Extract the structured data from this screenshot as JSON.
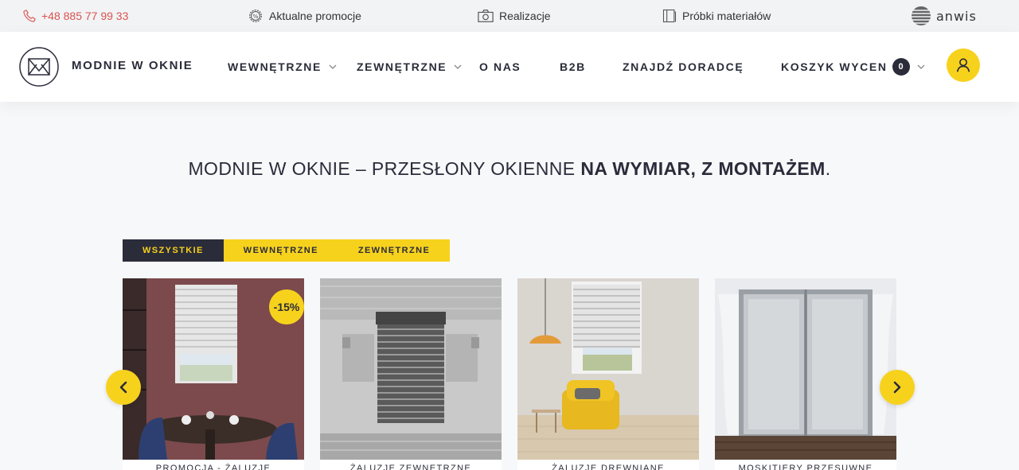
{
  "topbar": {
    "phone": "+48 885 77 99 33",
    "promotions": "Aktualne promocje",
    "realizations": "Realizacje",
    "samples": "Próbki materiałów",
    "partner_logo": "anwis"
  },
  "header": {
    "brand": "MODNIE W OKNIE",
    "nav": [
      {
        "label": "WEWNĘTRZNE",
        "has_dropdown": true
      },
      {
        "label": "ZEWNĘTRZNE",
        "has_dropdown": true
      },
      {
        "label": "O NAS"
      },
      {
        "label": "B2B"
      },
      {
        "label": "ZNAJDŹ DORADCĘ"
      },
      {
        "label": "KOSZYK WYCEN",
        "badge": "0",
        "has_dropdown": true
      }
    ],
    "user_icon": "user-icon"
  },
  "hero": {
    "headline_regular": "MODNIE W OKNIE – PRZESŁONY OKIENNE ",
    "headline_bold": "NA WYMIAR, Z MONTAŻEM",
    "headline_end": "."
  },
  "filters": [
    {
      "label": "WSZYSTKIE",
      "active": true
    },
    {
      "label": "WEWNĘTRZNE",
      "active": false
    },
    {
      "label": "ZEWNĘTRZNE",
      "active": false
    }
  ],
  "products": [
    {
      "caption": "PROMOCJA - ŻALUZJE",
      "badge": "-15%"
    },
    {
      "caption": "ŻALUZJE ZEWNĘTRZNE"
    },
    {
      "caption": "ŻALUZJE DREWNIANE"
    },
    {
      "caption": "MOSKITIERY PRZESUWNE"
    }
  ],
  "colors": {
    "accent": "#f7d21d",
    "dark": "#2b2c3a",
    "phone": "#d9534f"
  }
}
